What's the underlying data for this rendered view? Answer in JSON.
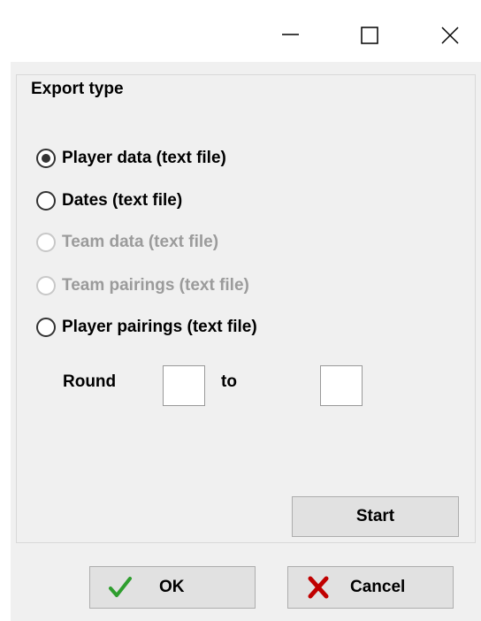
{
  "group": {
    "title": "Export type"
  },
  "options": [
    {
      "label": "Player data (text file)",
      "checked": true,
      "disabled": false
    },
    {
      "label": "Dates (text file)",
      "checked": false,
      "disabled": false
    },
    {
      "label": "Team data (text file)",
      "checked": false,
      "disabled": true
    },
    {
      "label": "Team pairings (text file)",
      "checked": false,
      "disabled": true
    },
    {
      "label": "Player pairings (text file)",
      "checked": false,
      "disabled": false
    }
  ],
  "round": {
    "label": "Round",
    "to_label": "to",
    "from_value": "",
    "to_value": ""
  },
  "buttons": {
    "start": "Start",
    "ok": "OK",
    "cancel": "Cancel"
  },
  "icons": {
    "minimize": "minimize-icon",
    "maximize": "maximize-icon",
    "close": "close-icon",
    "ok": "checkmark-icon",
    "cancel": "red-x-icon"
  },
  "colors": {
    "check_green": "#2e9e2e",
    "cancel_red": "#c00000",
    "background": "#f0f0f0"
  }
}
